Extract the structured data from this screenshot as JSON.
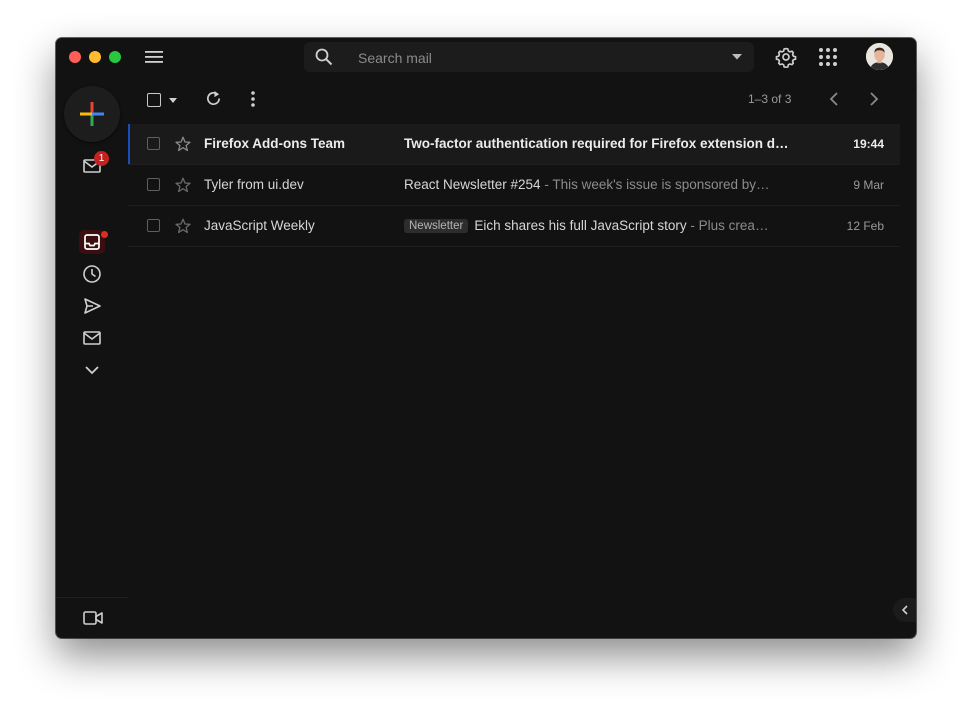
{
  "window": {
    "traffic_lights": [
      "close",
      "minimize",
      "maximize"
    ]
  },
  "header": {
    "menu_icon": "hamburger-menu-icon",
    "search": {
      "placeholder": "Search mail",
      "value": ""
    },
    "settings_icon": "gear-icon",
    "apps_icon": "apps-grid-icon"
  },
  "sidebar": {
    "compose_icon": "plus-icon",
    "items": [
      {
        "icon": "mail-icon",
        "badge": "1"
      },
      {
        "icon": "inbox-icon",
        "active": true
      },
      {
        "icon": "clock-icon"
      },
      {
        "icon": "send-icon"
      },
      {
        "icon": "envelope-icon"
      },
      {
        "icon": "chevron-down-icon"
      }
    ],
    "meet_icon": "video-camera-icon"
  },
  "toolbar": {
    "pager": "1–3 of 3"
  },
  "emails": [
    {
      "sender": "Firefox Add-ons Team",
      "label": "",
      "subject": "Two-factor authentication required for Firefox extension d…",
      "snippet": "",
      "date": "19:44",
      "unread": true
    },
    {
      "sender": "Tyler from ui.dev",
      "label": "",
      "subject": "React Newsletter #254",
      "snippet": " - This week's issue is sponsored by…",
      "date": "9 Mar",
      "unread": false
    },
    {
      "sender": "JavaScript Weekly",
      "label": "Newsletter",
      "subject": "Eich shares his full JavaScript story",
      "snippet": " - Plus crea…",
      "date": "12 Feb",
      "unread": false
    }
  ],
  "colors": {
    "background": "#121212",
    "badge": "#c5221f",
    "accent_blue": "#1a4fbb"
  }
}
